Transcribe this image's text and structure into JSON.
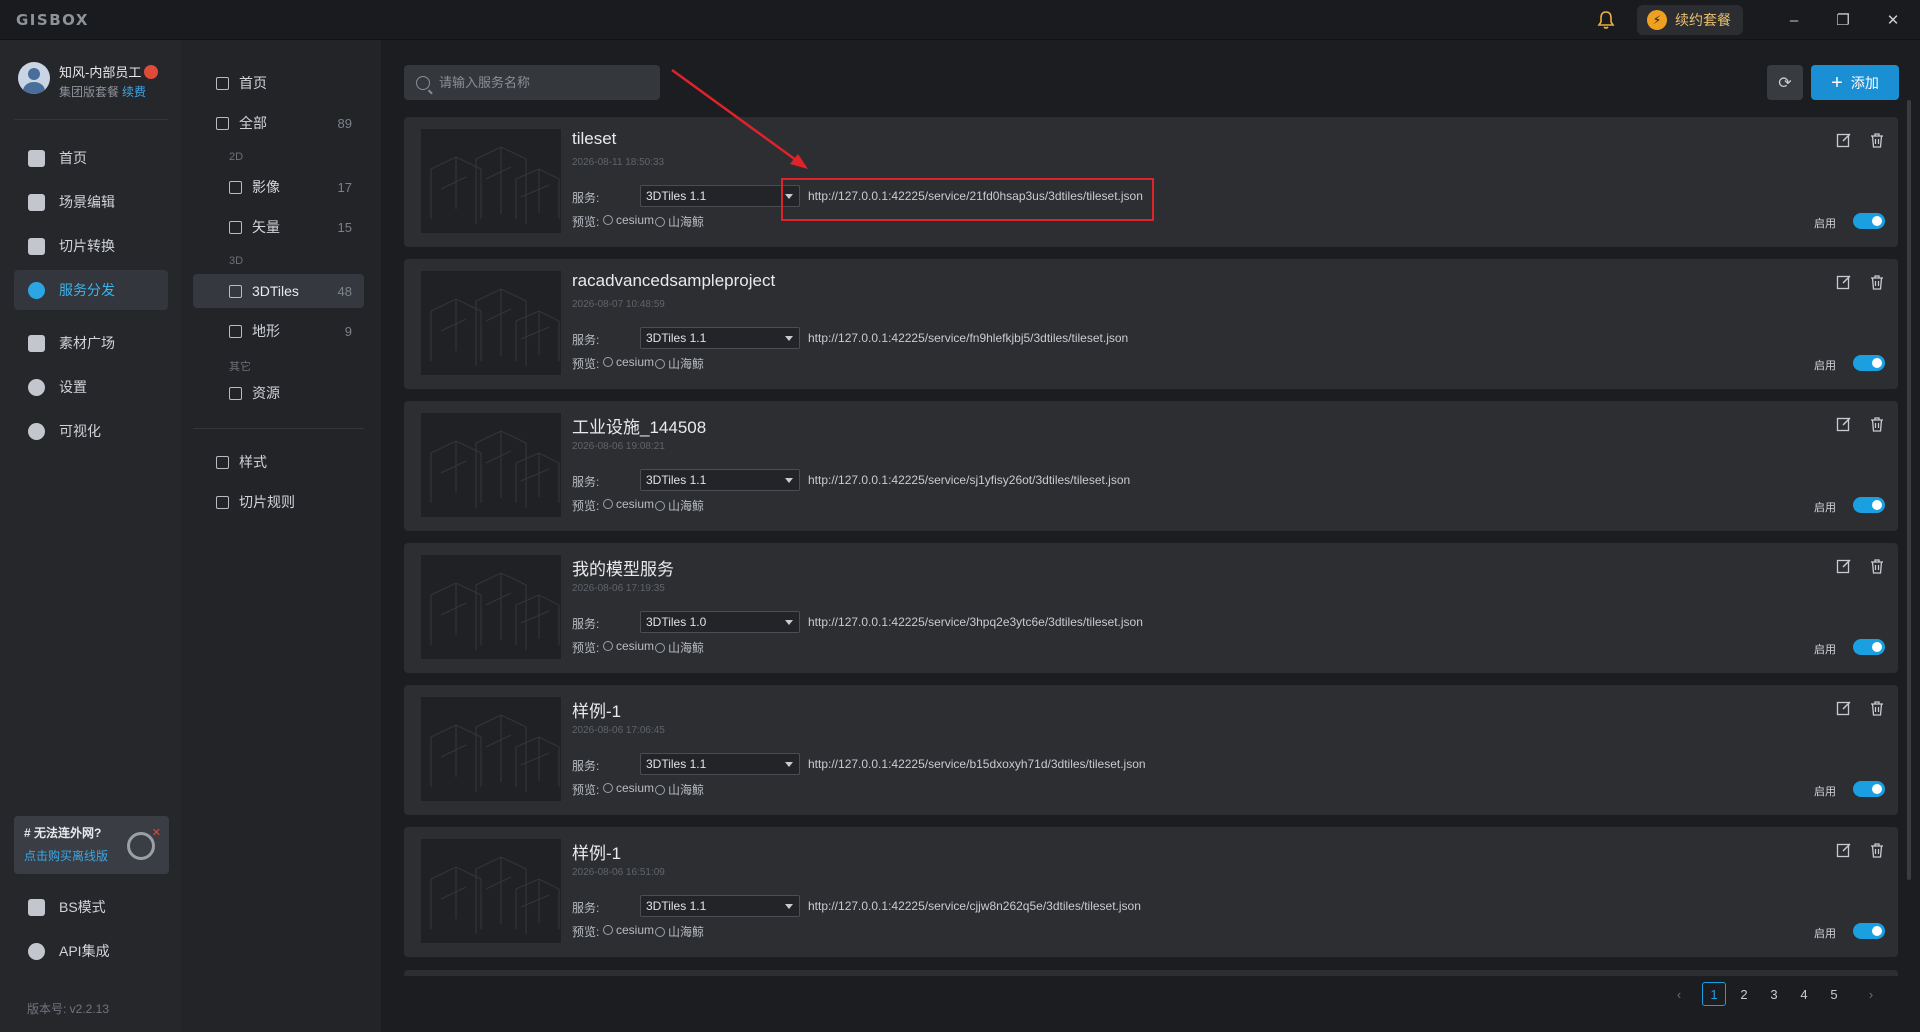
{
  "app": {
    "logo": "GISBOX",
    "plan_button": "续约套餐",
    "window": {
      "minimize": "–",
      "maximize": "❐",
      "close": "✕"
    }
  },
  "user": {
    "name": "知风-内部员工",
    "plan": "集团版套餐",
    "renew": "续费"
  },
  "nav": [
    {
      "id": "home",
      "label": "首页",
      "icon": "home-icon"
    },
    {
      "id": "scene",
      "label": "场景编辑",
      "icon": "cube-icon"
    },
    {
      "id": "tile",
      "label": "切片转换",
      "icon": "convert-icon"
    },
    {
      "id": "service",
      "label": "服务分发",
      "icon": "upload-icon",
      "active": true
    },
    {
      "id": "material",
      "label": "素材广场",
      "icon": "image-icon"
    },
    {
      "id": "settings",
      "label": "设置",
      "icon": "gear-icon"
    },
    {
      "id": "visual",
      "label": "可视化",
      "icon": "visual-icon"
    }
  ],
  "nav_bottom": [
    {
      "id": "bs",
      "label": "BS模式",
      "icon": "code-icon"
    },
    {
      "id": "api",
      "label": "API集成",
      "icon": "api-icon"
    }
  ],
  "promo": {
    "title": "# 无法连外网?",
    "link": "点击购买离线版"
  },
  "version": "版本号: v2.2.13",
  "subnav": {
    "home": "首页",
    "all": {
      "label": "全部",
      "count": "89"
    },
    "group_2d": "2D",
    "imagery": {
      "label": "影像",
      "count": "17"
    },
    "vector": {
      "label": "矢量",
      "count": "15"
    },
    "group_3d": "3D",
    "tiles": {
      "label": "3DTiles",
      "count": "48"
    },
    "terrain": {
      "label": "地形",
      "count": "9"
    },
    "group_other": "其它",
    "resource": "资源",
    "style": "样式",
    "tile_rules": "切片规则"
  },
  "search": {
    "placeholder": "请输入服务名称"
  },
  "add_button": "添加",
  "labels": {
    "service": "服务:",
    "preview": "预览:",
    "cesium": "cesium",
    "shanhai": "山海鲸",
    "enable": "启用"
  },
  "services": [
    {
      "title": "tileset",
      "date": "2026-08-11 18:50:33",
      "version": "3DTiles 1.1",
      "url": "http://127.0.0.1:42225/service/21fd0hsap3us/3dtiles/tileset.json",
      "enabled": true
    },
    {
      "title": "racadvancedsampleproject",
      "date": "2026-08-07 10:48:59",
      "version": "3DTiles 1.1",
      "url": "http://127.0.0.1:42225/service/fn9hlefkjbj5/3dtiles/tileset.json",
      "enabled": true
    },
    {
      "title": "工业设施_144508",
      "date": "2026-08-06 19:08:21",
      "version": "3DTiles 1.1",
      "url": "http://127.0.0.1:42225/service/sj1yfisy26ot/3dtiles/tileset.json",
      "enabled": true
    },
    {
      "title": "我的模型服务",
      "date": "2026-08-06 17:19:35",
      "version": "3DTiles 1.0",
      "url": "http://127.0.0.1:42225/service/3hpq2e3ytc6e/3dtiles/tileset.json",
      "enabled": true
    },
    {
      "title": "样例-1",
      "date": "2026-08-06 17:06:45",
      "version": "3DTiles 1.1",
      "url": "http://127.0.0.1:42225/service/b15dxoxyh71d/3dtiles/tileset.json",
      "enabled": true
    },
    {
      "title": "样例-1",
      "date": "2026-08-06 16:51:09",
      "version": "3DTiles 1.1",
      "url": "http://127.0.0.1:42225/service/cjjw8n262q5e/3dtiles/tileset.json",
      "enabled": true
    }
  ],
  "pagination": {
    "pages": [
      "1",
      "2",
      "3",
      "4",
      "5"
    ],
    "current": "1",
    "prev": "‹",
    "next": "›"
  },
  "colors": {
    "accent": "#1a9fe0",
    "active_nav": "#3cb4ea",
    "highlight": "#e0222a",
    "background": "#1c1d20"
  }
}
